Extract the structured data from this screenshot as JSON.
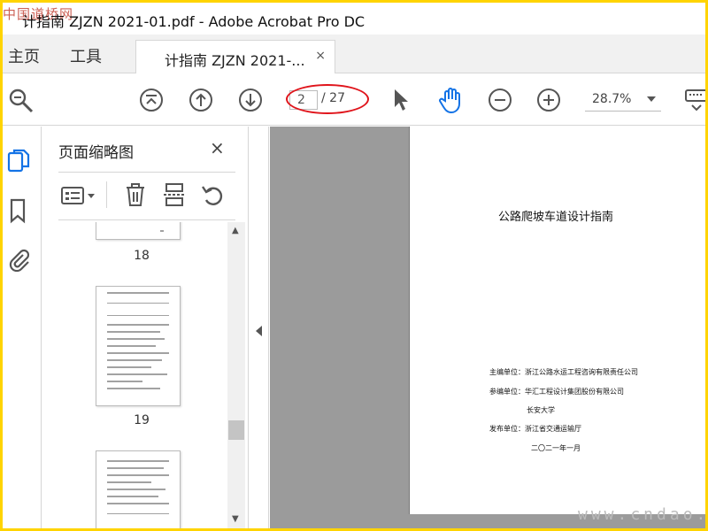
{
  "window": {
    "title": "计指南 ZJZN 2021-01.pdf - Adobe Acrobat Pro DC",
    "logo_text": "中国道桥网"
  },
  "tabs": {
    "home": "主页",
    "tools": "工具",
    "doc_tab": "计指南 ZJZN 2021-...",
    "close": "×"
  },
  "toolbar": {
    "icons": [
      "search-icon",
      "first-page-icon",
      "prev-page-icon",
      "next-page-icon",
      "select-arrow-icon",
      "hand-icon",
      "zoom-out-icon",
      "zoom-in-icon",
      "keyboard-icon"
    ],
    "page_input": "2",
    "page_total": "/ 27",
    "zoom": "28.7%",
    "accent_color": "#1473e6",
    "annotation_color": "#e0141b"
  },
  "panel": {
    "title": "页面缩略图",
    "close": "×",
    "tools": [
      "options-menu-icon",
      "delete-icon",
      "extract-icon",
      "rotate-icon"
    ],
    "thumbnails": [
      {
        "label": "18"
      },
      {
        "label": "19"
      },
      {
        "label": ""
      }
    ]
  },
  "page": {
    "heading": "公路爬坡车道设计指南",
    "chief_editor": "主编单位：浙江公路水运工程咨询有限责任公司",
    "co_editor": "参编单位：华汇工程设计集团股份有限公司",
    "co_editor_2": "长安大学",
    "publisher": "发布单位：浙江省交通运输厅",
    "date": "二〇二一年一月"
  },
  "watermark": {
    "site": "www.cndao.com"
  }
}
